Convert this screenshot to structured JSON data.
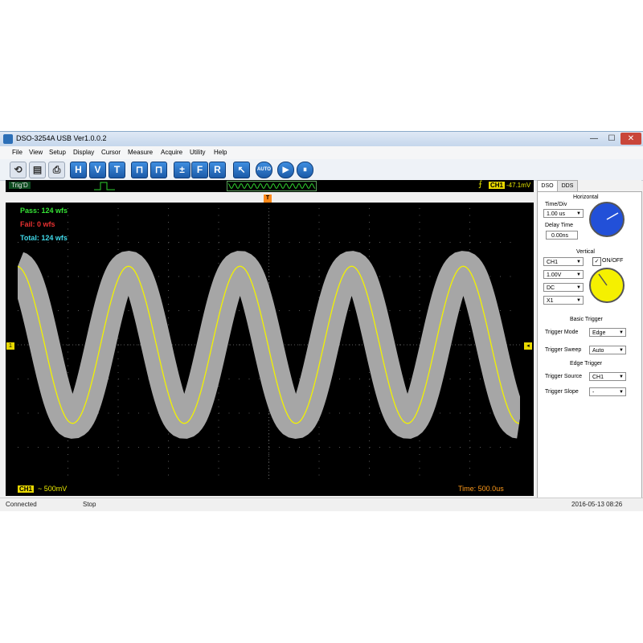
{
  "window": {
    "title": "DSO-3254A USB Ver1.0.0.2",
    "min": "—",
    "max": "☐",
    "close": "✕"
  },
  "menu": [
    "File",
    "View",
    "Setup",
    "Display",
    "Cursor",
    "Measure",
    "Acquire",
    "Utility",
    "Help"
  ],
  "toolbar": [
    {
      "name": "load-icon",
      "glyph": "⟲"
    },
    {
      "name": "save-icon",
      "glyph": "▤"
    },
    {
      "name": "print-icon",
      "glyph": "⎙"
    },
    {
      "name": "horizontal-button",
      "glyph": "H"
    },
    {
      "name": "vertical-button",
      "glyph": "V"
    },
    {
      "name": "trigger-button",
      "glyph": "T"
    },
    {
      "name": "measure-pulse-button",
      "glyph": "⊓"
    },
    {
      "name": "measure-list-button",
      "glyph": "⊓"
    },
    {
      "name": "math-button",
      "glyph": "±"
    },
    {
      "name": "fft-button",
      "glyph": "F"
    },
    {
      "name": "reference-button",
      "glyph": "R"
    },
    {
      "name": "cursor-button",
      "glyph": "↖"
    },
    {
      "name": "autoset-button",
      "glyph": "AUTO"
    },
    {
      "name": "run-button",
      "glyph": "▶"
    },
    {
      "name": "stop-button",
      "glyph": "⏸"
    }
  ],
  "scope": {
    "trig_status": "Trig'D",
    "trigger_channel": "CH1",
    "trigger_level": "-47.1mV",
    "pass": "Pass: 124 wfs",
    "fail": "Fail: 0 wfs",
    "total": "Total: 124 wfs",
    "ch_label": "CH1",
    "ch_volt": "~ 500mV",
    "timebase": "Time: 500.0us",
    "trigger_marker": "T",
    "ch_marker": "1",
    "colors": {
      "trace": "#f2f200",
      "mask": "#a6a6a6",
      "grid": "#5a5a5a"
    },
    "waveform": {
      "cycles": 4.5,
      "amplitude_divisions": 2.3,
      "phase_start": "peak-descending"
    }
  },
  "panel": {
    "tabs": [
      "DSO",
      "DDS"
    ],
    "horizontal_title": "Horizontal",
    "time_div_label": "Time/Div",
    "time_div_value": "1.00 us",
    "delay_label": "Delay Time",
    "delay_value": "0.00ns",
    "vertical_title": "Vertical",
    "channel_value": "CH1",
    "onoff_label": "ON/OFF",
    "onoff_checked": "✓",
    "volt_value": "1.00V",
    "coupling_value": "DC",
    "probe_value": "X1",
    "basic_trigger_title": "Basic Trigger",
    "trigger_mode_label": "Trigger Mode",
    "trigger_mode_value": "Edge",
    "trigger_sweep_label": "Trigger Sweep",
    "trigger_sweep_value": "Auto",
    "edge_trigger_title": "Edge Trigger",
    "trigger_source_label": "Trigger Source",
    "trigger_source_value": "CH1",
    "trigger_slope_label": "Trigger Slope",
    "trigger_slope_value": "-",
    "knob_horizontal_color": "#2250d8",
    "knob_vertical_color": "#f5f000"
  },
  "status": {
    "connection": "Connected",
    "run_state": "Stop",
    "datetime": "2016-05-13   08:26"
  }
}
